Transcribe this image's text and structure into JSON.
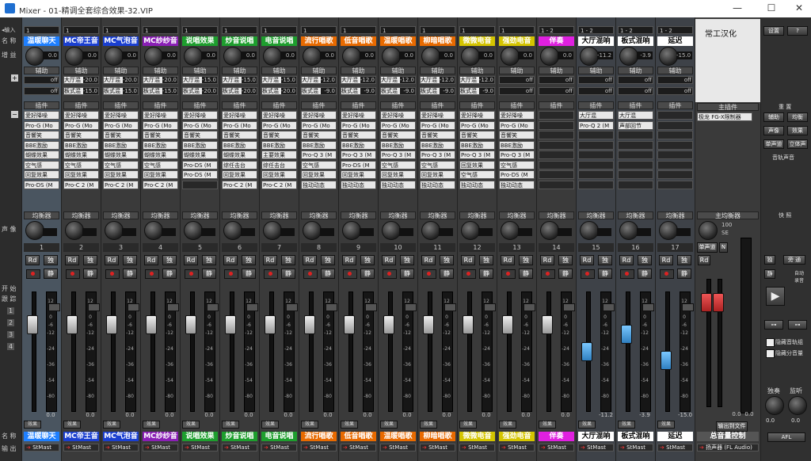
{
  "window": {
    "title": "Mixer - 01-精调全套综合效果-32.VIP",
    "min": "—",
    "max": "☐",
    "close": "✕"
  },
  "left": {
    "input": "◂输入",
    "name": "名 称",
    "gain": "增 益",
    "add": "+",
    "sub": "−",
    "pan": "声 像",
    "rec": "开 始",
    "follow": "跟 踪",
    "nums": [
      "1",
      "2",
      "3",
      "4"
    ],
    "name_bottom": "名 称",
    "out": "输 出"
  },
  "section_labels": {
    "send": "辅助",
    "plugin": "插件",
    "eq": "均衡器"
  },
  "channels": [
    {
      "n": "1",
      "name": "温暖聊天",
      "color": "#1e7fff",
      "input": "1",
      "plugins": [
        "愛好降噪",
        "Pro-G (Mo",
        "音響笑",
        "BBE激励",
        "蝴蝶效果",
        "空气感",
        "回复效果",
        "Pro-DS (M"
      ],
      "sends": [
        [
          "off",
          ""
        ],
        [
          "off",
          ""
        ]
      ],
      "db": "0.0",
      "sel": true
    },
    {
      "n": "2",
      "name": "MC帝王音",
      "color": "#1a3fd0",
      "input": "1",
      "plugins": [
        "愛好降噪",
        "Pro-G (Mo",
        "音響笑",
        "BBE激励",
        "蝴蝶效果",
        "空气感",
        "回复效果",
        "Pro-C 2 (M"
      ],
      "sends": [
        [
          "大厅混",
          "-20.0"
        ],
        [
          "板式混",
          "-15.0"
        ]
      ],
      "db": "0.0"
    },
    {
      "n": "3",
      "name": "MC气泡音",
      "color": "#1a3fd0",
      "input": "1",
      "plugins": [
        "愛好降噪",
        "Pro-G (Mo",
        "音響笑",
        "BBE激励",
        "蝴蝶效果",
        "空气感",
        "回复效果",
        "Pro-C 2 (M"
      ],
      "sends": [
        [
          "大厅混",
          "-20.0"
        ],
        [
          "板式混",
          "-15.0"
        ]
      ],
      "db": "0.0"
    },
    {
      "n": "4",
      "name": "MC纱纱音",
      "color": "#8a1fb5",
      "input": "1",
      "plugins": [
        "愛好降噪",
        "Pro-G (Mo",
        "音響笑",
        "BBE激励",
        "蝴蝶效果",
        "空气感",
        "回复效果",
        "Pro-C 2 (M"
      ],
      "sends": [
        [
          "大厅混",
          "-20.0"
        ],
        [
          "板式混",
          "-15.0"
        ]
      ],
      "db": "0.0"
    },
    {
      "n": "5",
      "name": "说唱效果",
      "color": "#1e9e2e",
      "input": "1",
      "plugins": [
        "愛好降噪",
        "Pro-G (Mo",
        "音響笑",
        "BBE激励",
        "蝴蝶效果",
        "Pro-DS (M",
        "Pro-DS (M",
        ""
      ],
      "sends": [
        [
          "大厅混",
          "-15.0"
        ],
        [
          "板式混",
          "-20.0"
        ]
      ],
      "db": "0.0"
    },
    {
      "n": "6",
      "name": "炒音说唱",
      "color": "#1e9e2e",
      "input": "1",
      "plugins": [
        "愛好降噪",
        "Pro-G (Mo",
        "音響笑",
        "BBE激励",
        "蝴蝶效果",
        "综任击台",
        "回复效果",
        "Pro-C 2 (M"
      ],
      "sends": [
        [
          "大厅混",
          "-15.0"
        ],
        [
          "板式混",
          "-20.0"
        ]
      ],
      "db": "0.0"
    },
    {
      "n": "7",
      "name": "电音说唱",
      "color": "#1e9e2e",
      "input": "1",
      "plugins": [
        "愛好降噪",
        "Pro-G (Mo",
        "音響笑",
        "BBE激励",
        "主要效果",
        "综任击台",
        "回复效果",
        "Pro-C 2 (M"
      ],
      "sends": [
        [
          "大厅混",
          "-15.0"
        ],
        [
          "板式混",
          "-20.0"
        ]
      ],
      "db": "0.0"
    },
    {
      "n": "8",
      "name": "流行唱歌",
      "color": "#e86a00",
      "input": "1",
      "plugins": [
        "愛好降噪",
        "Pro-G (Mo",
        "音響笑",
        "BBE激励",
        "Pro-Q 3 (M",
        "空气感",
        "回复效果",
        "独动动态"
      ],
      "sends": [
        [
          "大厅混",
          "-12.0"
        ],
        [
          "板式混",
          "-9.0"
        ]
      ],
      "db": "0.0"
    },
    {
      "n": "9",
      "name": "低音唱歌",
      "color": "#e86a00",
      "input": "1",
      "plugins": [
        "愛好降噪",
        "Pro-G (Mo",
        "音響笑",
        "BBE激励",
        "Pro-Q 3 (M",
        "Pro-DS (M",
        "回复效果",
        "独动动态"
      ],
      "sends": [
        [
          "大厅混",
          "-12.0"
        ],
        [
          "板式混",
          "-9.0"
        ]
      ],
      "db": "0.0"
    },
    {
      "n": "10",
      "name": "温暖唱歌",
      "color": "#e86a00",
      "input": "1",
      "plugins": [
        "愛好降噪",
        "Pro-G (Mo",
        "音響笑",
        "BBE激励",
        "Pro-Q 3 (M",
        "空气感",
        "回复效果",
        "独动动态"
      ],
      "sends": [
        [
          "大厅混",
          "-12.0"
        ],
        [
          "板式混",
          "-9.0"
        ]
      ],
      "db": "0.0"
    },
    {
      "n": "11",
      "name": "柳暗唱歌",
      "color": "#e86a00",
      "input": "1",
      "plugins": [
        "愛好降噪",
        "Pro-G (Mo",
        "音響笑",
        "BBE激励",
        "Pro-Q 3 (M",
        "空气感",
        "回复效果",
        "独动动态"
      ],
      "sends": [
        [
          "大厅混",
          "-12.0"
        ],
        [
          "板式混",
          "-9.0"
        ]
      ],
      "db": "0.0"
    },
    {
      "n": "12",
      "name": "微微电音",
      "color": "#d4c400",
      "input": "1",
      "plugins": [
        "愛好降噪",
        "Pro-G (Mo",
        "音響笑",
        "BBE激励",
        "Pro-Q 3 (M",
        "回复效果",
        "空气感",
        "独动动态"
      ],
      "sends": [
        [
          "大厅混",
          "-12.0"
        ],
        [
          "板式混",
          "-9.0"
        ]
      ],
      "db": "0.0"
    },
    {
      "n": "13",
      "name": "强劲电音",
      "color": "#d4c400",
      "input": "1",
      "plugins": [
        "愛好降噪",
        "Pro-G (Mo",
        "音響笑",
        "BBE激励",
        "Pro-Q 3 (M",
        "空气感",
        "Pro-DS (M",
        "独动动态"
      ],
      "sends": [
        [
          "off",
          ""
        ],
        [
          "off",
          ""
        ]
      ],
      "db": "0.0"
    },
    {
      "n": "14",
      "name": "伴奏",
      "color": "#e020e0",
      "input": "1 - 2",
      "plugins": [
        "",
        "",
        "",
        "",
        "",
        "",
        "",
        ""
      ],
      "sends": [
        [
          "off",
          ""
        ],
        [
          "off",
          ""
        ]
      ],
      "db": "0.0"
    },
    {
      "n": "15",
      "name": "大厅混响",
      "color": "#ffffff",
      "input": "1 - 2",
      "plugins": [
        "大厅混",
        "Pro-Q 2 (M",
        "",
        "",
        "",
        "",
        "",
        ""
      ],
      "sends": [
        [
          "off",
          ""
        ],
        [
          "off",
          ""
        ]
      ],
      "db": "-11.2",
      "stereo": true
    },
    {
      "n": "16",
      "name": "板式混响",
      "color": "#ffffff",
      "input": "1 - 2",
      "plugins": [
        "大厅混",
        "声部回节",
        "",
        "",
        "",
        "",
        "",
        ""
      ],
      "sends": [
        [
          "off",
          ""
        ],
        [
          "off",
          ""
        ]
      ],
      "db": "-3.9",
      "stereo": true
    },
    {
      "n": "17",
      "name": "延迟",
      "color": "#ffffff",
      "input": "1 - 2",
      "plugins": [
        "",
        "",
        "",
        "",
        "",
        "",
        "",
        ""
      ],
      "sends": [
        [
          "off",
          ""
        ],
        [
          "off",
          ""
        ]
      ],
      "db": "-15.0",
      "stereo": true
    }
  ],
  "buttons": {
    "rd": "Rd",
    "solo": "独",
    "mute": "静"
  },
  "fader_scale": [
    "12",
    "6",
    "0",
    "-6",
    "-12",
    "-18",
    "-24",
    "-30",
    "-36",
    "-42",
    "-54",
    "-66",
    "-80",
    "-90"
  ],
  "output_label": "StMast",
  "eff_label": "效果",
  "main": {
    "title": "常工汉化",
    "plugin_label": "主插件",
    "plugins": [
      "极龙 FG-X限制器",
      ""
    ],
    "eq": "主均衡器",
    "pan_val": "100",
    "pan_unit": "SE",
    "sim": "单声道",
    "n": "N",
    "name": "总音量控制",
    "out": "扬声器 (FL Audio)",
    "db_l": "0.0",
    "db_r": "0.0",
    "outfile": "输出到文件"
  },
  "right": {
    "settings": "设置",
    "help": "?",
    "reset": "重 置",
    "aux": "辅助",
    "eq": "均衡",
    "pan": "声像",
    "eff": "效果",
    "mono": "单声道",
    "stereo": "立体声",
    "trackcue": "音轨声音",
    "quick": "快 照",
    "solo": "独",
    "bypass": "旁 通",
    "mute": "静",
    "auto_play": "自动",
    "auto_play2": "录音",
    "hide_group": "隐藏音轨组",
    "hide_send": "隐藏分音量",
    "solo2": "独奏",
    "monitor": "监听",
    "afl": "AFL",
    "m1": "0.0",
    "m2": "0.0"
  }
}
